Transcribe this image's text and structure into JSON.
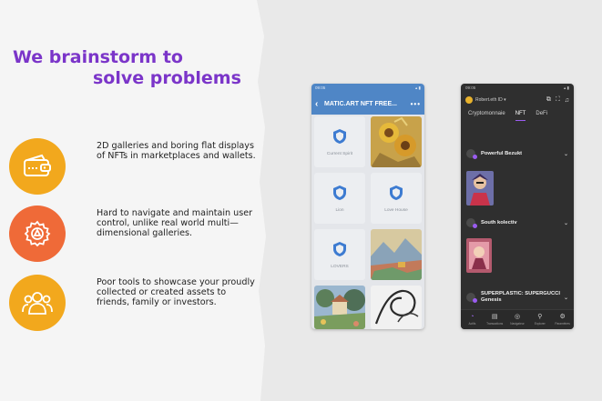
{
  "headline": {
    "line1": "We brainstorm to",
    "line2": "solve problems"
  },
  "points": [
    {
      "icon": "wallet-icon",
      "color": "#f2a81d",
      "text": "2D galleries and boring flat displays of NFTs in marketplaces and wallets."
    },
    {
      "icon": "gear-icon",
      "color": "#ef6a38",
      "text": "Hard to navigate and maintain user control, unlike real world multi—dimensional galleries."
    },
    {
      "icon": "people-icon",
      "color": "#f2a81d",
      "text": "Poor tools to showcase your proudly collected or created assets to friends, family or investors."
    }
  ],
  "phone1": {
    "status_time": "09:05",
    "status_icons": "▴ ▮",
    "back": "‹",
    "title": "MATIC.ART NFT FREE...",
    "more": "•••",
    "cells": {
      "c1_caption": "Current Spirit",
      "c3_caption": "Lion",
      "c4_caption": "Love House",
      "c5_caption": "LOVERS"
    }
  },
  "phone2": {
    "status_time": "09:05",
    "status_icons": "▴ ▮",
    "account": "Robert.eth ID",
    "account_caret": "▾",
    "tabs": [
      "Cryptomonnaie",
      "NFT",
      "DeFi"
    ],
    "active_tab": "NFT",
    "collections": [
      {
        "name": "Powerful Bezukt"
      },
      {
        "name": "South kolectiv"
      },
      {
        "name": "SUPERPLASTIC: SUPERGUCCI Genesis"
      }
    ],
    "nav": [
      {
        "icon": "◔",
        "label": "Actifs"
      },
      {
        "icon": "▤",
        "label": "Transactions"
      },
      {
        "icon": "◎",
        "label": "Navigateur"
      },
      {
        "icon": "⚲",
        "label": "Explorer"
      },
      {
        "icon": "⚙",
        "label": "Paramètres"
      }
    ],
    "chevron": "⌄"
  },
  "colors": {
    "headline": "#7b35c9",
    "yellow": "#f2a81d",
    "orange": "#ef6a38",
    "phone1_header": "#4f86c6",
    "phone2_bg": "#2f2f2f",
    "accent_purple": "#9a5cf0"
  }
}
